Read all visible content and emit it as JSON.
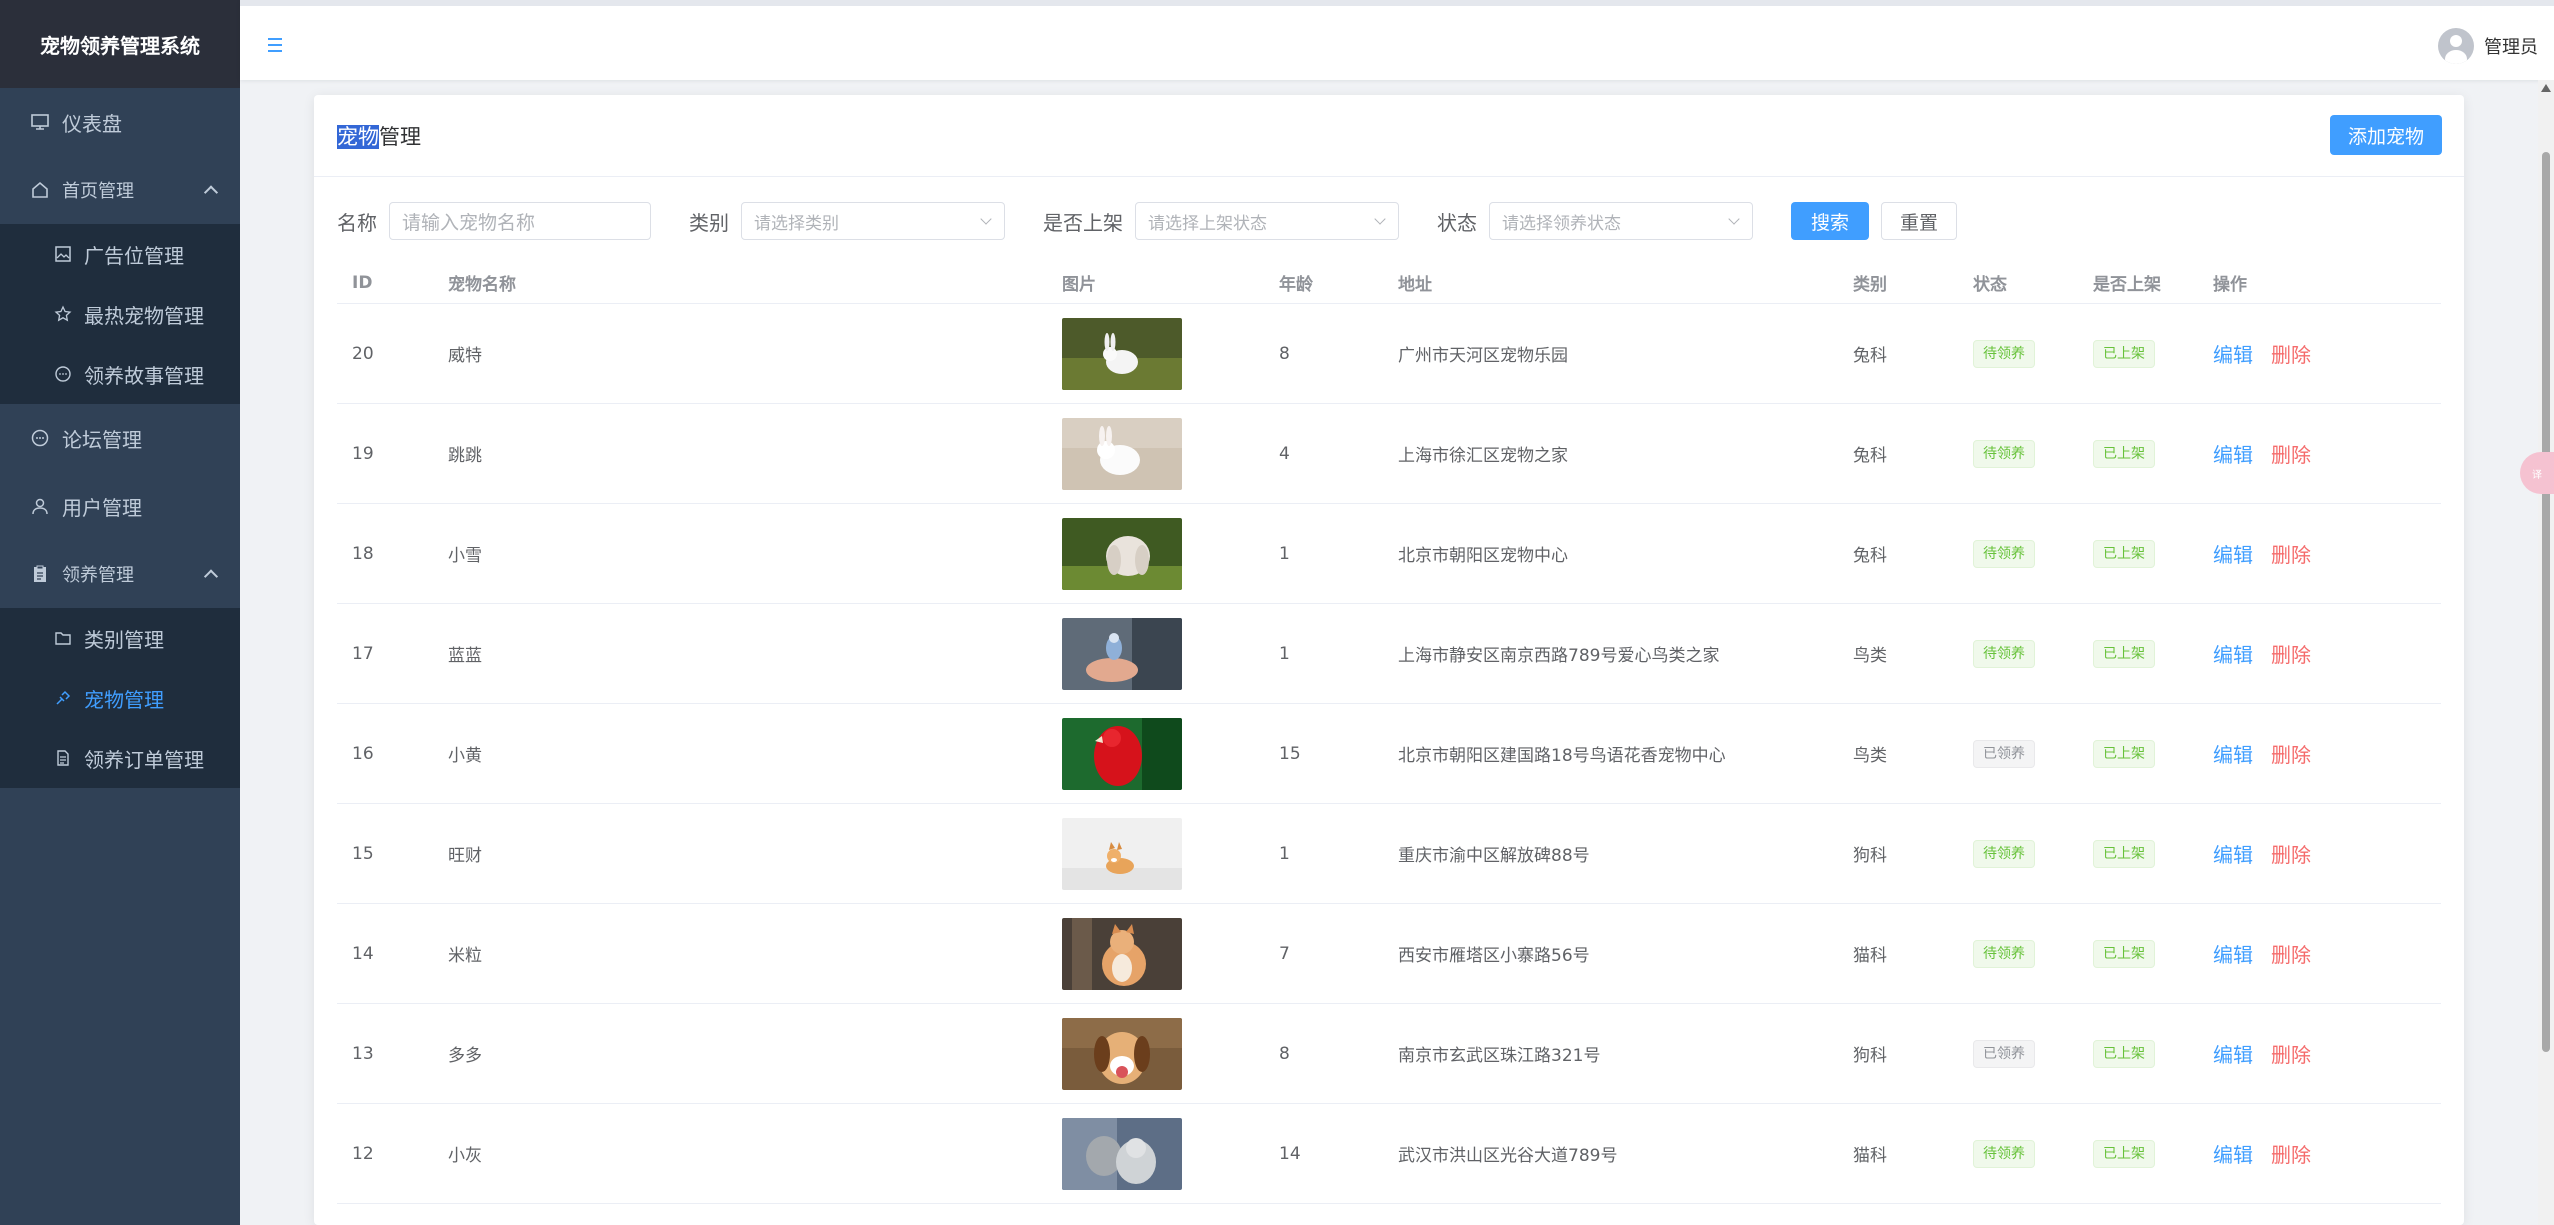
{
  "app": {
    "brand": "宠物领养管理系统",
    "user_name": "管理员"
  },
  "sidebar": {
    "items": [
      {
        "label": "仪表盘",
        "icon": "dashboard-icon"
      },
      {
        "label": "首页管理",
        "icon": "home-icon",
        "expanded": true,
        "children": [
          {
            "label": "广告位管理",
            "icon": "picture-icon"
          },
          {
            "label": "最热宠物管理",
            "icon": "star-icon"
          },
          {
            "label": "领养故事管理",
            "icon": "chat-icon"
          }
        ]
      },
      {
        "label": "论坛管理",
        "icon": "chat-icon"
      },
      {
        "label": "用户管理",
        "icon": "user-icon"
      },
      {
        "label": "领养管理",
        "icon": "clipboard-icon",
        "expanded": true,
        "children": [
          {
            "label": "类别管理",
            "icon": "folder-icon"
          },
          {
            "label": "宠物管理",
            "icon": "link-icon",
            "active": true
          },
          {
            "label": "领养订单管理",
            "icon": "document-icon"
          }
        ]
      }
    ]
  },
  "card": {
    "title_selected": "宠物",
    "title_rest": "管理",
    "add_button": "添加宠物"
  },
  "filters": {
    "name_label": "名称",
    "name_placeholder": "请输入宠物名称",
    "category_label": "类别",
    "category_placeholder": "请选择类别",
    "shelf_label": "是否上架",
    "shelf_placeholder": "请选择上架状态",
    "status_label": "状态",
    "status_placeholder": "请选择领养状态",
    "search_button": "搜索",
    "reset_button": "重置"
  },
  "table": {
    "columns": [
      "ID",
      "宠物名称",
      "图片",
      "年龄",
      "地址",
      "类别",
      "状态",
      "是否上架",
      "操作"
    ],
    "edit_label": "编辑",
    "delete_label": "删除",
    "rows": [
      {
        "id": "20",
        "name": "威特",
        "age": "8",
        "address": "广州市天河区宠物乐园",
        "category": "兔科",
        "status": "待领养",
        "shelf": "已上架",
        "img": "white-rabbit-on-grass"
      },
      {
        "id": "19",
        "name": "跳跳",
        "age": "4",
        "address": "上海市徐汇区宠物之家",
        "category": "兔科",
        "status": "待领养",
        "shelf": "已上架",
        "img": "white-rabbit-on-rug"
      },
      {
        "id": "18",
        "name": "小雪",
        "age": "1",
        "address": "北京市朝阳区宠物中心",
        "category": "兔科",
        "status": "待领养",
        "shelf": "已上架",
        "img": "lop-rabbit-on-grass"
      },
      {
        "id": "17",
        "name": "蓝蓝",
        "age": "1",
        "address": "上海市静安区南京西路789号爱心鸟类之家",
        "category": "鸟类",
        "status": "待领养",
        "shelf": "已上架",
        "img": "bird-on-hand"
      },
      {
        "id": "16",
        "name": "小黄",
        "age": "15",
        "address": "北京市朝阳区建国路18号鸟语花香宠物中心",
        "category": "鸟类",
        "status": "已领养",
        "shelf": "已上架",
        "img": "red-parrot"
      },
      {
        "id": "15",
        "name": "旺财",
        "age": "1",
        "address": "重庆市渝中区解放碑88号",
        "category": "狗科",
        "status": "待领养",
        "shelf": "已上架",
        "img": "corgi-puppy"
      },
      {
        "id": "14",
        "name": "米粒",
        "age": "7",
        "address": "西安市雁塔区小寨路56号",
        "category": "猫科",
        "status": "待领养",
        "shelf": "已上架",
        "img": "orange-cat"
      },
      {
        "id": "13",
        "name": "多多",
        "age": "8",
        "address": "南京市玄武区珠江路321号",
        "category": "狗科",
        "status": "已领养",
        "shelf": "已上架",
        "img": "beagle-dog"
      },
      {
        "id": "12",
        "name": "小灰",
        "age": "14",
        "address": "武汉市洪山区光谷大道789号",
        "category": "猫科",
        "status": "待领养",
        "shelf": "已上架",
        "img": "gray-cats"
      }
    ]
  },
  "colors": {
    "primary": "#409eff",
    "danger": "#f56c6c",
    "success": "#67c23a",
    "sidebar": "#304156"
  }
}
